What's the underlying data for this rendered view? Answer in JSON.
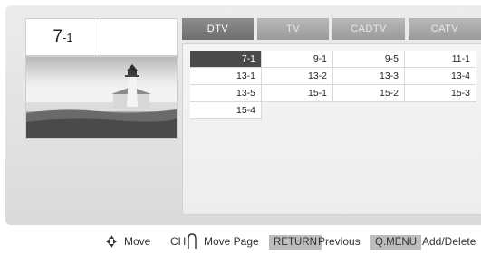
{
  "current_channel": {
    "main": "7",
    "sub": "-1"
  },
  "tabs": [
    {
      "label": "DTV",
      "active": true
    },
    {
      "label": "TV",
      "active": false
    },
    {
      "label": "CADTV",
      "active": false
    },
    {
      "label": "CATV",
      "active": false
    }
  ],
  "channels": {
    "row1": [
      "7-1",
      "9-1",
      "9-5",
      "11-1"
    ],
    "row2": [
      "13-1",
      "13-2",
      "13-3",
      "13-4"
    ],
    "row3": [
      "13-5",
      "15-1",
      "15-2",
      "15-3"
    ],
    "row4": [
      "15-4"
    ],
    "selected": "7-1"
  },
  "help": {
    "move": "Move",
    "ch_prefix": "CH",
    "move_page": "Move Page",
    "return_key": "RETURN",
    "previous": "Previous",
    "qmenu_key": "Q.MENU",
    "add_delete": "Add/Delete"
  },
  "colors": {
    "accent": "#4a4a4a",
    "tab_active": "#7a7a7a",
    "tab_inactive": "#a8a8a8"
  }
}
